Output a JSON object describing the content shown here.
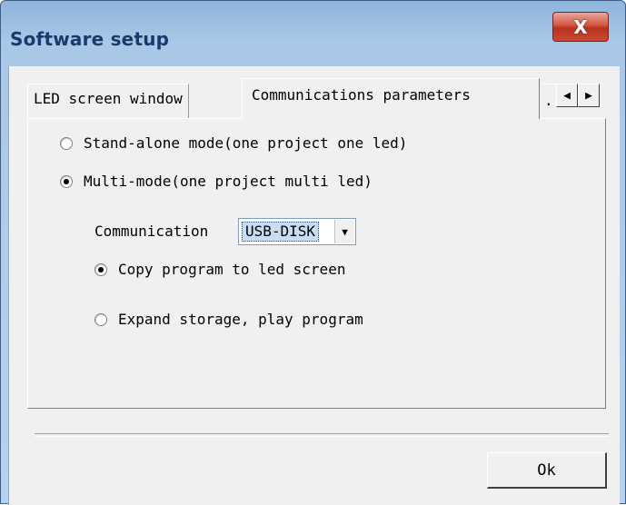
{
  "window": {
    "title": "Software setup",
    "close_glyph": "X"
  },
  "tabs": [
    {
      "label": "LED screen window",
      "active": false
    },
    {
      "label": "Communications parameters",
      "active": true
    },
    {
      "label": ".",
      "active": false
    }
  ],
  "tab_scroll": {
    "left_icon": "◀",
    "right_icon": "▶"
  },
  "mode": {
    "options": [
      {
        "label": "Stand-alone mode(one project one led)",
        "checked": false
      },
      {
        "label": "Multi-mode(one project multi led)",
        "checked": true
      }
    ]
  },
  "communication": {
    "label": "Communication",
    "selected": "USB-DISK",
    "dropdown_icon": "▼"
  },
  "action": {
    "options": [
      {
        "label": "Copy program to led screen",
        "checked": true
      },
      {
        "label": "Expand storage, play program",
        "checked": false
      }
    ]
  },
  "footer": {
    "ok_label": "Ok"
  },
  "colors": {
    "title_text": "#1a3a6e",
    "close_button": "#c94a33",
    "dialog_bg": "#f0f0f0",
    "selection_highlight": "#c8dcf2"
  }
}
